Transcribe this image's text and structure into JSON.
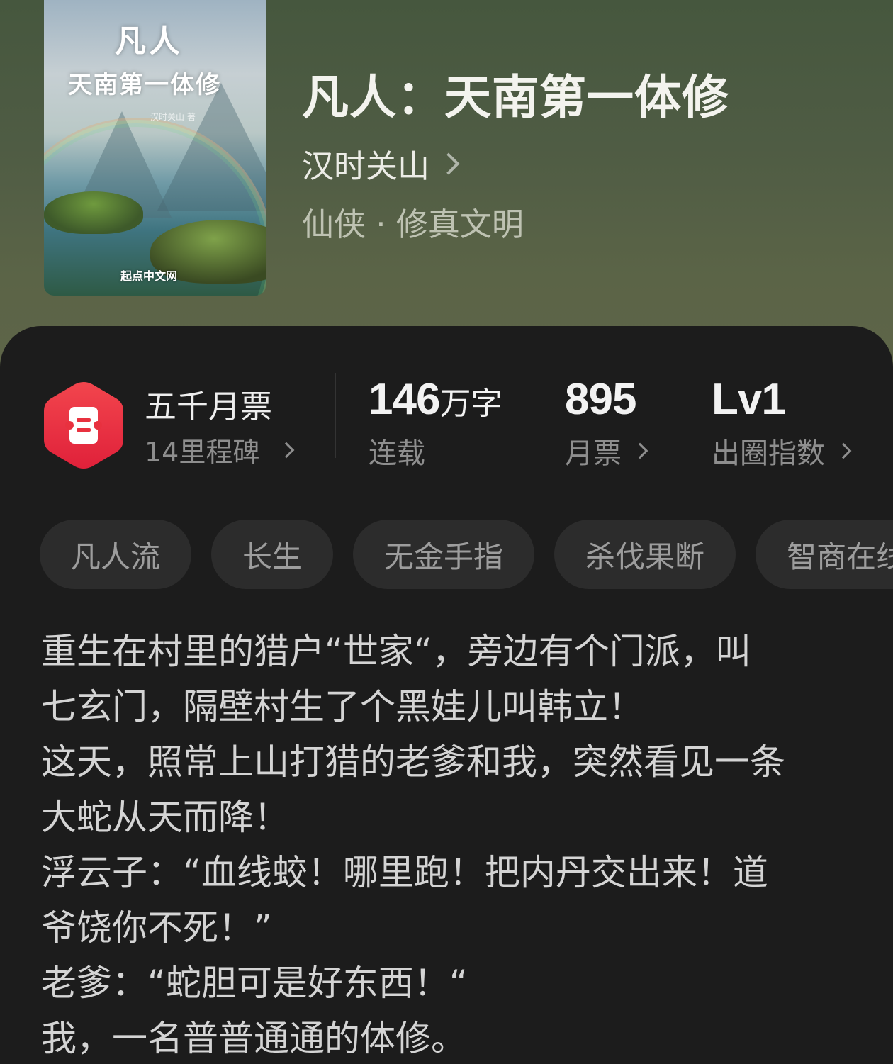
{
  "book": {
    "title": "凡人：天南第一体修",
    "author": "汉时关山",
    "genre": "仙侠 · 修真文明",
    "cover": {
      "title_line1": "凡人",
      "title_line2": "天南第一体修",
      "author_text": "汉时关山 著",
      "publisher": "起点中文网"
    }
  },
  "milestone": {
    "title": "五千月票",
    "subtitle": "14里程碑",
    "icon": "ticket-icon",
    "color": "#e8313f"
  },
  "stats": {
    "words": {
      "num": "146",
      "unit": "万字",
      "label": "连载"
    },
    "tickets": {
      "num": "895",
      "label": "月票"
    },
    "level": {
      "num": "Lv1",
      "label": "出圈指数"
    }
  },
  "tags": [
    "凡人流",
    "长生",
    "无金手指",
    "杀伐果断",
    "智商在线"
  ],
  "synopsis": "重生在村里的猎户“世家“，旁边有个门派，叫\n七玄门，隔壁村生了个黑娃儿叫韩立！\n这天，照常上山打猎的老爹和我，突然看见一条\n大蛇从天而降！\n浮云子：“血线蛟！哪里跑！把内丹交出来！道\n爷饶你不死！”\n老爹：“蛇胆可是好东西！“\n我，一名普普通通的体修。"
}
